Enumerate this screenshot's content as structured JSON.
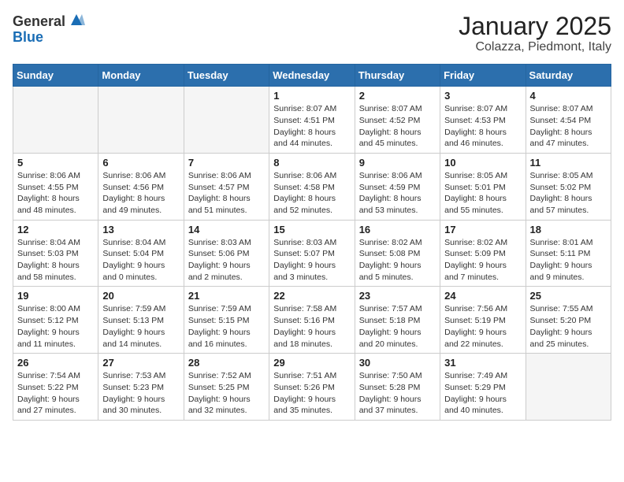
{
  "header": {
    "logo_general": "General",
    "logo_blue": "Blue",
    "title": "January 2025",
    "subtitle": "Colazza, Piedmont, Italy"
  },
  "days_of_week": [
    "Sunday",
    "Monday",
    "Tuesday",
    "Wednesday",
    "Thursday",
    "Friday",
    "Saturday"
  ],
  "weeks": [
    [
      {
        "day": "",
        "info": ""
      },
      {
        "day": "",
        "info": ""
      },
      {
        "day": "",
        "info": ""
      },
      {
        "day": "1",
        "info": "Sunrise: 8:07 AM\nSunset: 4:51 PM\nDaylight: 8 hours\nand 44 minutes."
      },
      {
        "day": "2",
        "info": "Sunrise: 8:07 AM\nSunset: 4:52 PM\nDaylight: 8 hours\nand 45 minutes."
      },
      {
        "day": "3",
        "info": "Sunrise: 8:07 AM\nSunset: 4:53 PM\nDaylight: 8 hours\nand 46 minutes."
      },
      {
        "day": "4",
        "info": "Sunrise: 8:07 AM\nSunset: 4:54 PM\nDaylight: 8 hours\nand 47 minutes."
      }
    ],
    [
      {
        "day": "5",
        "info": "Sunrise: 8:06 AM\nSunset: 4:55 PM\nDaylight: 8 hours\nand 48 minutes."
      },
      {
        "day": "6",
        "info": "Sunrise: 8:06 AM\nSunset: 4:56 PM\nDaylight: 8 hours\nand 49 minutes."
      },
      {
        "day": "7",
        "info": "Sunrise: 8:06 AM\nSunset: 4:57 PM\nDaylight: 8 hours\nand 51 minutes."
      },
      {
        "day": "8",
        "info": "Sunrise: 8:06 AM\nSunset: 4:58 PM\nDaylight: 8 hours\nand 52 minutes."
      },
      {
        "day": "9",
        "info": "Sunrise: 8:06 AM\nSunset: 4:59 PM\nDaylight: 8 hours\nand 53 minutes."
      },
      {
        "day": "10",
        "info": "Sunrise: 8:05 AM\nSunset: 5:01 PM\nDaylight: 8 hours\nand 55 minutes."
      },
      {
        "day": "11",
        "info": "Sunrise: 8:05 AM\nSunset: 5:02 PM\nDaylight: 8 hours\nand 57 minutes."
      }
    ],
    [
      {
        "day": "12",
        "info": "Sunrise: 8:04 AM\nSunset: 5:03 PM\nDaylight: 8 hours\nand 58 minutes."
      },
      {
        "day": "13",
        "info": "Sunrise: 8:04 AM\nSunset: 5:04 PM\nDaylight: 9 hours\nand 0 minutes."
      },
      {
        "day": "14",
        "info": "Sunrise: 8:03 AM\nSunset: 5:06 PM\nDaylight: 9 hours\nand 2 minutes."
      },
      {
        "day": "15",
        "info": "Sunrise: 8:03 AM\nSunset: 5:07 PM\nDaylight: 9 hours\nand 3 minutes."
      },
      {
        "day": "16",
        "info": "Sunrise: 8:02 AM\nSunset: 5:08 PM\nDaylight: 9 hours\nand 5 minutes."
      },
      {
        "day": "17",
        "info": "Sunrise: 8:02 AM\nSunset: 5:09 PM\nDaylight: 9 hours\nand 7 minutes."
      },
      {
        "day": "18",
        "info": "Sunrise: 8:01 AM\nSunset: 5:11 PM\nDaylight: 9 hours\nand 9 minutes."
      }
    ],
    [
      {
        "day": "19",
        "info": "Sunrise: 8:00 AM\nSunset: 5:12 PM\nDaylight: 9 hours\nand 11 minutes."
      },
      {
        "day": "20",
        "info": "Sunrise: 7:59 AM\nSunset: 5:13 PM\nDaylight: 9 hours\nand 14 minutes."
      },
      {
        "day": "21",
        "info": "Sunrise: 7:59 AM\nSunset: 5:15 PM\nDaylight: 9 hours\nand 16 minutes."
      },
      {
        "day": "22",
        "info": "Sunrise: 7:58 AM\nSunset: 5:16 PM\nDaylight: 9 hours\nand 18 minutes."
      },
      {
        "day": "23",
        "info": "Sunrise: 7:57 AM\nSunset: 5:18 PM\nDaylight: 9 hours\nand 20 minutes."
      },
      {
        "day": "24",
        "info": "Sunrise: 7:56 AM\nSunset: 5:19 PM\nDaylight: 9 hours\nand 22 minutes."
      },
      {
        "day": "25",
        "info": "Sunrise: 7:55 AM\nSunset: 5:20 PM\nDaylight: 9 hours\nand 25 minutes."
      }
    ],
    [
      {
        "day": "26",
        "info": "Sunrise: 7:54 AM\nSunset: 5:22 PM\nDaylight: 9 hours\nand 27 minutes."
      },
      {
        "day": "27",
        "info": "Sunrise: 7:53 AM\nSunset: 5:23 PM\nDaylight: 9 hours\nand 30 minutes."
      },
      {
        "day": "28",
        "info": "Sunrise: 7:52 AM\nSunset: 5:25 PM\nDaylight: 9 hours\nand 32 minutes."
      },
      {
        "day": "29",
        "info": "Sunrise: 7:51 AM\nSunset: 5:26 PM\nDaylight: 9 hours\nand 35 minutes."
      },
      {
        "day": "30",
        "info": "Sunrise: 7:50 AM\nSunset: 5:28 PM\nDaylight: 9 hours\nand 37 minutes."
      },
      {
        "day": "31",
        "info": "Sunrise: 7:49 AM\nSunset: 5:29 PM\nDaylight: 9 hours\nand 40 minutes."
      },
      {
        "day": "",
        "info": ""
      }
    ]
  ]
}
